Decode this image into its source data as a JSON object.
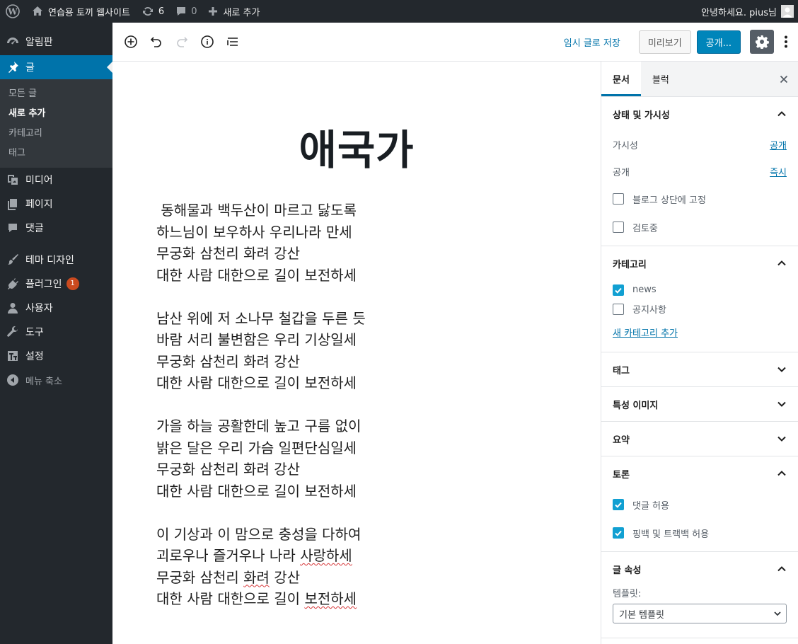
{
  "adminbar": {
    "site_name": "연습용 토끼 웹사이트",
    "updates_count": "6",
    "comments_count": "0",
    "new_label": "새로 추가",
    "greeting": "안녕하세요. pius님"
  },
  "sidebar": {
    "dashboard": "알림판",
    "posts": "글",
    "posts_sub": [
      "모든 글",
      "새로 추가",
      "카테고리",
      "태그"
    ],
    "media": "미디어",
    "pages": "페이지",
    "comments": "댓글",
    "appearance": "테마 디자인",
    "plugins": "플러그인",
    "plugins_badge": "1",
    "users": "사용자",
    "tools": "도구",
    "settings": "설정",
    "collapse": "메뉴 축소"
  },
  "toolbar": {
    "save_draft": "임시 글로 저장",
    "preview": "미리보기",
    "publish": "공개..."
  },
  "post": {
    "title": "애국가",
    "stanzas": [
      [
        " 동해물과 백두산이 마르고 닳도록",
        "하느님이 보우하사 우리나라 만세",
        "무궁화 삼천리 화려 강산",
        "대한 사람 대한으로 길이 보전하세"
      ],
      [
        "남산 위에 저 소나무 철갑을 두른 듯",
        "바람 서리 불변함은 우리 기상일세",
        "무궁화 삼천리 화려 강산",
        "대한 사람 대한으로 길이 보전하세"
      ],
      [
        "가을 하늘 공활한데 높고 구름 없이",
        "밝은 달은 우리 가슴 일편단심일세",
        "무궁화 삼천리 화려 강산",
        "대한 사람 대한으로 길이 보전하세"
      ],
      [
        "이 기상과 이 맘으로 충성을 다하여",
        "괴로우나 즐거우나 나라 ",
        "무궁화 삼천리 ",
        "대한 사람 대한으로 길이 "
      ]
    ],
    "squiggle_words": [
      "사랑하세",
      "화려",
      "보전하세"
    ],
    "squiggle_tails": [
      " 강산"
    ]
  },
  "settings": {
    "tabs": [
      "문서",
      "블럭"
    ],
    "status_panel": {
      "title": "상태 및 가시성",
      "visibility_label": "가시성",
      "visibility_value": "공개",
      "publish_label": "공개",
      "publish_value": "즉시",
      "sticky_label": "블로그 상단에 고정",
      "pending_label": "검토중"
    },
    "categories_panel": {
      "title": "카테고리",
      "items": [
        {
          "label": "news",
          "checked": true
        },
        {
          "label": "공지사항",
          "checked": false
        }
      ],
      "add_link": "새 카테고리 추가"
    },
    "tags_panel": "태그",
    "featured_panel": "특성 이미지",
    "excerpt_panel": "요약",
    "discussion_panel": {
      "title": "토론",
      "allow_comments": "댓글 허용",
      "allow_pings": "핑백 및 트랙백 허용"
    },
    "attributes_panel": {
      "title": "글 속성",
      "template_label": "템플릿:",
      "template_value": "기본 템플릿"
    }
  },
  "colors": {
    "adminbar_bg": "#23282d",
    "accent": "#0073aa",
    "publish_bg": "#0085ba",
    "checkbox_on": "#11a0d2",
    "badge": "#ca4a1f"
  }
}
